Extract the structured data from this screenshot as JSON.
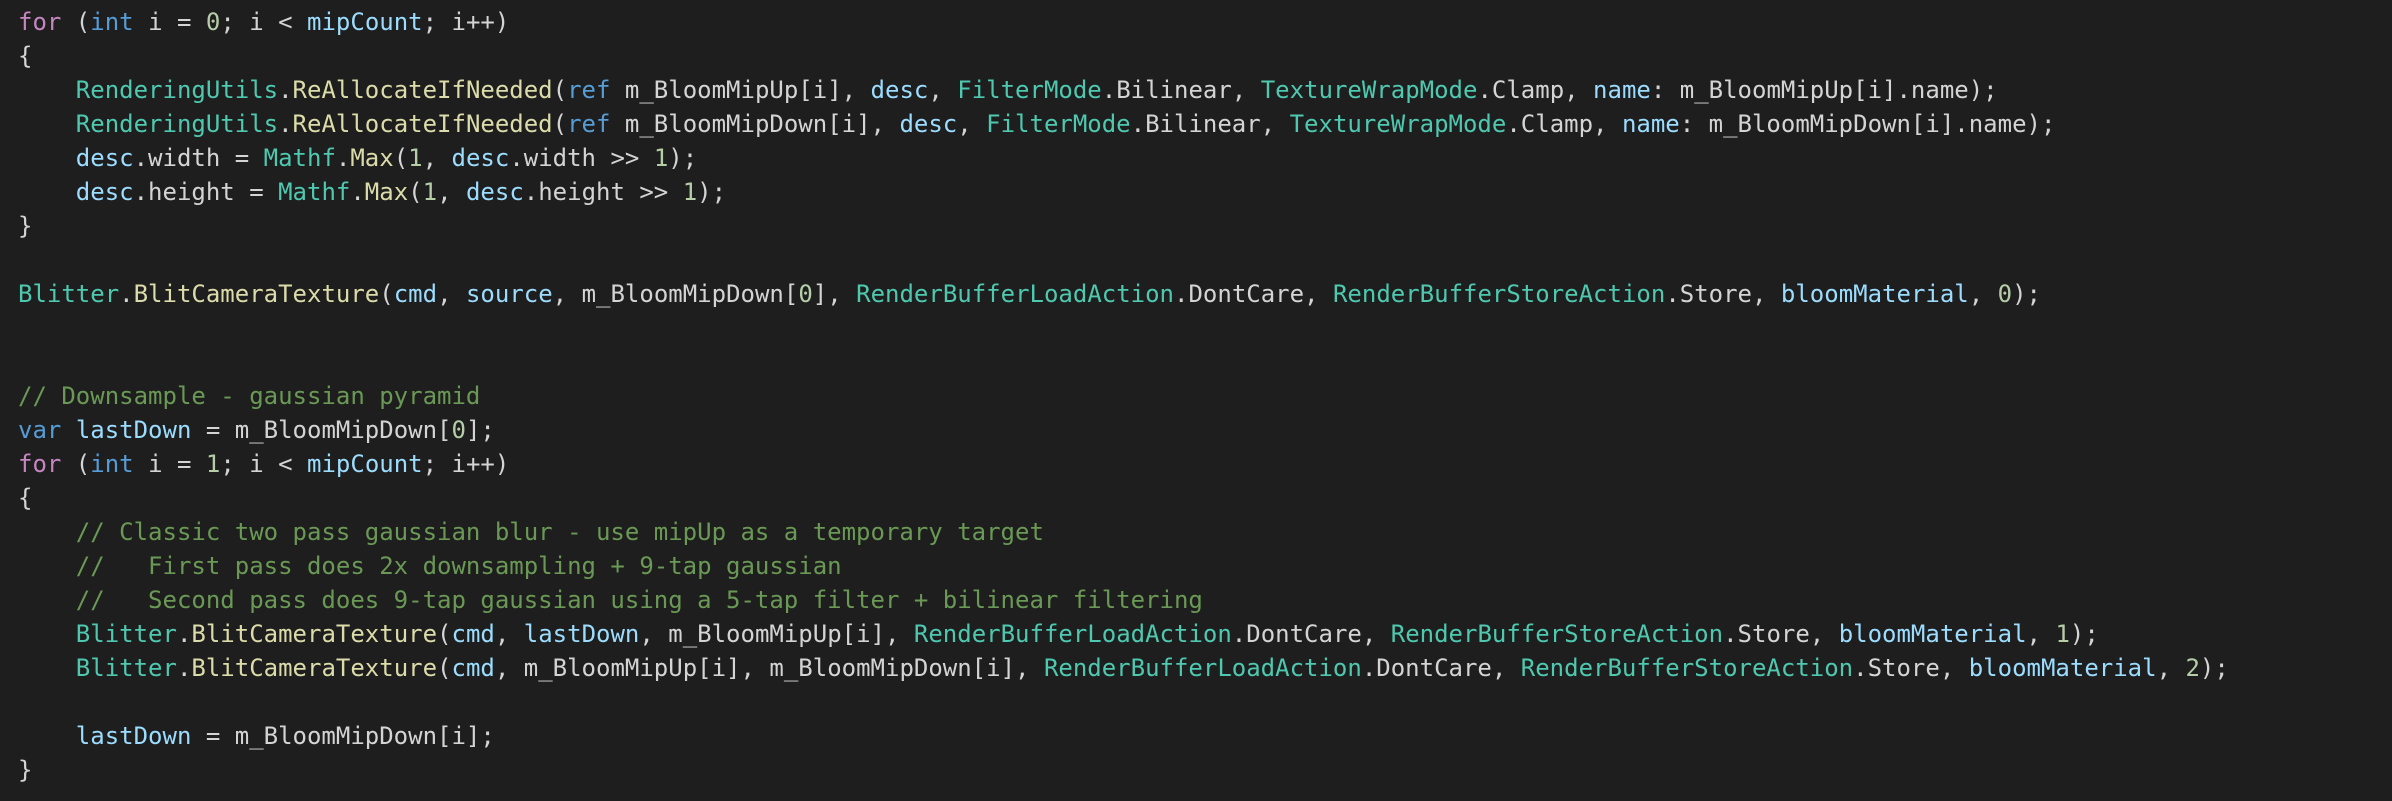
{
  "lines": [
    [
      [
        "kw2",
        "for"
      ],
      [
        "pn",
        " ("
      ],
      [
        "kw",
        "int"
      ],
      [
        "pn",
        " i = "
      ],
      [
        "num",
        "0"
      ],
      [
        "pn",
        "; i < "
      ],
      [
        "var",
        "mipCount"
      ],
      [
        "pn",
        "; i++)"
      ]
    ],
    [
      [
        "pn",
        "{"
      ]
    ],
    [
      [
        "pn",
        "    "
      ],
      [
        "type",
        "RenderingUtils"
      ],
      [
        "pn",
        "."
      ],
      [
        "fn",
        "ReAllocateIfNeeded"
      ],
      [
        "pn",
        "("
      ],
      [
        "kw",
        "ref"
      ],
      [
        "pn",
        " m_BloomMipUp[i], "
      ],
      [
        "var",
        "desc"
      ],
      [
        "pn",
        ", "
      ],
      [
        "type",
        "FilterMode"
      ],
      [
        "pn",
        ".Bilinear, "
      ],
      [
        "type",
        "TextureWrapMode"
      ],
      [
        "pn",
        ".Clamp, "
      ],
      [
        "var",
        "name"
      ],
      [
        "pn",
        ": m_BloomMipUp[i].name);"
      ]
    ],
    [
      [
        "pn",
        "    "
      ],
      [
        "type",
        "RenderingUtils"
      ],
      [
        "pn",
        "."
      ],
      [
        "fn",
        "ReAllocateIfNeeded"
      ],
      [
        "pn",
        "("
      ],
      [
        "kw",
        "ref"
      ],
      [
        "pn",
        " m_BloomMipDown[i], "
      ],
      [
        "var",
        "desc"
      ],
      [
        "pn",
        ", "
      ],
      [
        "type",
        "FilterMode"
      ],
      [
        "pn",
        ".Bilinear, "
      ],
      [
        "type",
        "TextureWrapMode"
      ],
      [
        "pn",
        ".Clamp, "
      ],
      [
        "var",
        "name"
      ],
      [
        "pn",
        ": m_BloomMipDown[i].name);"
      ]
    ],
    [
      [
        "pn",
        "    "
      ],
      [
        "var",
        "desc"
      ],
      [
        "pn",
        ".width = "
      ],
      [
        "type",
        "Mathf"
      ],
      [
        "pn",
        "."
      ],
      [
        "fn",
        "Max"
      ],
      [
        "pn",
        "("
      ],
      [
        "num",
        "1"
      ],
      [
        "pn",
        ", "
      ],
      [
        "var",
        "desc"
      ],
      [
        "pn",
        ".width >> "
      ],
      [
        "num",
        "1"
      ],
      [
        "pn",
        ");"
      ]
    ],
    [
      [
        "pn",
        "    "
      ],
      [
        "var",
        "desc"
      ],
      [
        "pn",
        ".height = "
      ],
      [
        "type",
        "Mathf"
      ],
      [
        "pn",
        "."
      ],
      [
        "fn",
        "Max"
      ],
      [
        "pn",
        "("
      ],
      [
        "num",
        "1"
      ],
      [
        "pn",
        ", "
      ],
      [
        "var",
        "desc"
      ],
      [
        "pn",
        ".height >> "
      ],
      [
        "num",
        "1"
      ],
      [
        "pn",
        ");"
      ]
    ],
    [
      [
        "pn",
        "}"
      ]
    ],
    [],
    [
      [
        "type",
        "Blitter"
      ],
      [
        "pn",
        "."
      ],
      [
        "fn",
        "BlitCameraTexture"
      ],
      [
        "pn",
        "("
      ],
      [
        "var",
        "cmd"
      ],
      [
        "pn",
        ", "
      ],
      [
        "var",
        "source"
      ],
      [
        "pn",
        ", m_BloomMipDown["
      ],
      [
        "num",
        "0"
      ],
      [
        "pn",
        "], "
      ],
      [
        "type",
        "RenderBufferLoadAction"
      ],
      [
        "pn",
        ".DontCare, "
      ],
      [
        "type",
        "RenderBufferStoreAction"
      ],
      [
        "pn",
        ".Store, "
      ],
      [
        "var",
        "bloomMaterial"
      ],
      [
        "pn",
        ", "
      ],
      [
        "num",
        "0"
      ],
      [
        "pn",
        ");"
      ]
    ],
    [],
    [],
    [
      [
        "cmt",
        "// Downsample - gaussian pyramid"
      ]
    ],
    [
      [
        "kw",
        "var"
      ],
      [
        "pn",
        " "
      ],
      [
        "var",
        "lastDown"
      ],
      [
        "pn",
        " = m_BloomMipDown["
      ],
      [
        "num",
        "0"
      ],
      [
        "pn",
        "];"
      ]
    ],
    [
      [
        "kw2",
        "for"
      ],
      [
        "pn",
        " ("
      ],
      [
        "kw",
        "int"
      ],
      [
        "pn",
        " i = "
      ],
      [
        "num",
        "1"
      ],
      [
        "pn",
        "; i < "
      ],
      [
        "var",
        "mipCount"
      ],
      [
        "pn",
        "; i++)"
      ]
    ],
    [
      [
        "pn",
        "{"
      ]
    ],
    [
      [
        "pn",
        "    "
      ],
      [
        "cmt",
        "// Classic two pass gaussian blur - use mipUp as a temporary target"
      ]
    ],
    [
      [
        "pn",
        "    "
      ],
      [
        "cmt",
        "//   First pass does 2x downsampling + 9-tap gaussian"
      ]
    ],
    [
      [
        "pn",
        "    "
      ],
      [
        "cmt",
        "//   Second pass does 9-tap gaussian using a 5-tap filter + bilinear filtering"
      ]
    ],
    [
      [
        "pn",
        "    "
      ],
      [
        "type",
        "Blitter"
      ],
      [
        "pn",
        "."
      ],
      [
        "fn",
        "BlitCameraTexture"
      ],
      [
        "pn",
        "("
      ],
      [
        "var",
        "cmd"
      ],
      [
        "pn",
        ", "
      ],
      [
        "var",
        "lastDown"
      ],
      [
        "pn",
        ", m_BloomMipUp[i], "
      ],
      [
        "type",
        "RenderBufferLoadAction"
      ],
      [
        "pn",
        ".DontCare, "
      ],
      [
        "type",
        "RenderBufferStoreAction"
      ],
      [
        "pn",
        ".Store, "
      ],
      [
        "var",
        "bloomMaterial"
      ],
      [
        "pn",
        ", "
      ],
      [
        "num",
        "1"
      ],
      [
        "pn",
        ");"
      ]
    ],
    [
      [
        "pn",
        "    "
      ],
      [
        "type",
        "Blitter"
      ],
      [
        "pn",
        "."
      ],
      [
        "fn",
        "BlitCameraTexture"
      ],
      [
        "pn",
        "("
      ],
      [
        "var",
        "cmd"
      ],
      [
        "pn",
        ", m_BloomMipUp[i], m_BloomMipDown[i], "
      ],
      [
        "type",
        "RenderBufferLoadAction"
      ],
      [
        "pn",
        ".DontCare, "
      ],
      [
        "type",
        "RenderBufferStoreAction"
      ],
      [
        "pn",
        ".Store, "
      ],
      [
        "var",
        "bloomMaterial"
      ],
      [
        "pn",
        ", "
      ],
      [
        "num",
        "2"
      ],
      [
        "pn",
        ");"
      ]
    ],
    [],
    [
      [
        "pn",
        "    "
      ],
      [
        "var",
        "lastDown"
      ],
      [
        "pn",
        " = m_BloomMipDown[i];"
      ]
    ],
    [
      [
        "pn",
        "}"
      ]
    ]
  ]
}
